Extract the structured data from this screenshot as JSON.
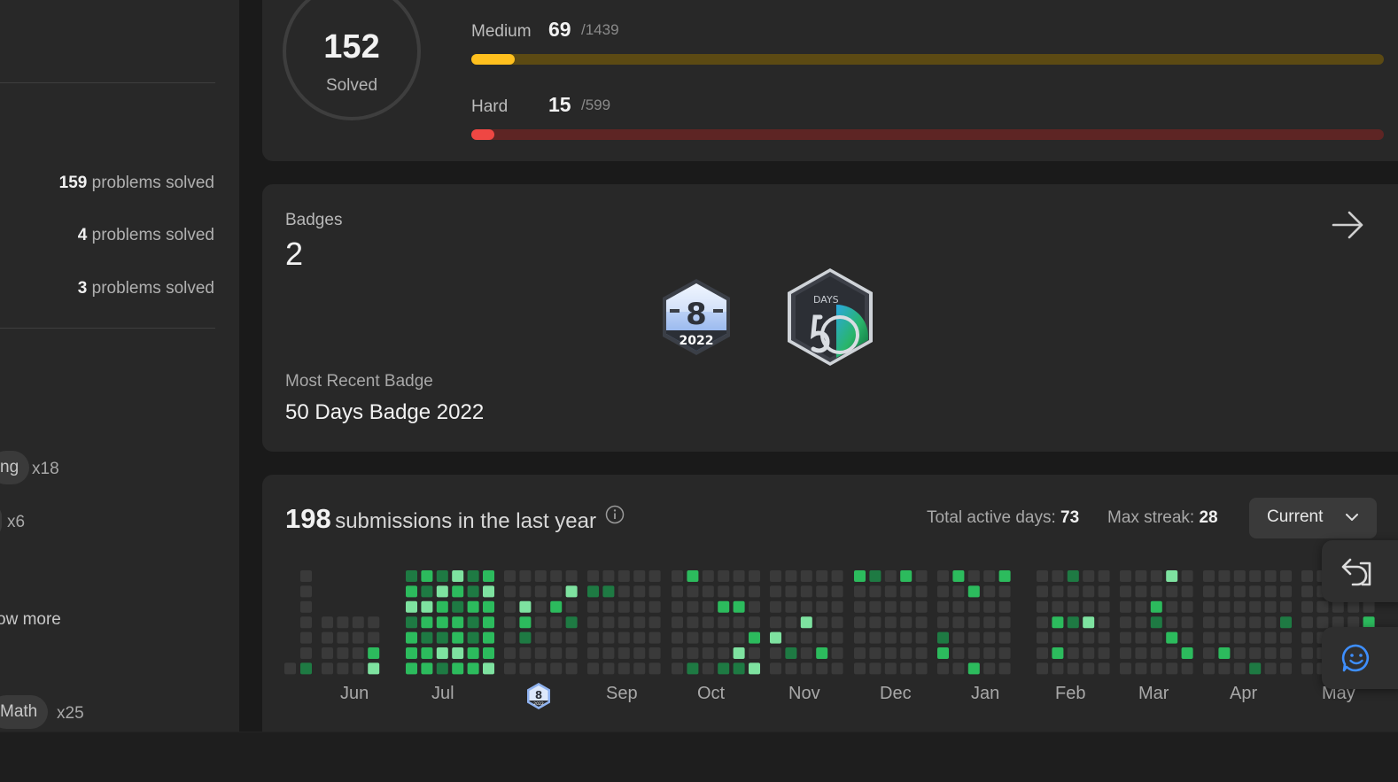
{
  "languages": [
    {
      "count": "159",
      "suffix": "problems solved"
    },
    {
      "count": "4",
      "suffix": "problems solved"
    },
    {
      "count": "3",
      "suffix": "problems solved"
    }
  ],
  "skills": [
    {
      "name": "ng",
      "count": "x18"
    },
    {
      "name": "",
      "count": "x6"
    },
    {
      "name": "Math",
      "count": "x25"
    }
  ],
  "show_more": "ow more",
  "solved": {
    "count": "152",
    "label": "Solved"
  },
  "difficulties": [
    {
      "label": "Medium",
      "solved": "69",
      "total": "/1439",
      "progress": 0.048,
      "color": "#ffc01e",
      "track": "#5c4a13"
    },
    {
      "label": "Hard",
      "solved": "15",
      "total": "/599",
      "progress": 0.025,
      "color": "#ef4743",
      "track": "#5e2524"
    }
  ],
  "badges": {
    "label": "Badges",
    "count": "2",
    "recent_label": "Most Recent Badge",
    "recent_name": "50 Days Badge 2022",
    "badge_1_text": {
      "number": "8",
      "year": "2022"
    },
    "badge_2_text": {
      "top": "DAYS",
      "number": "50"
    }
  },
  "calendar": {
    "submissions": "198",
    "submissions_text": "submissions in the last year",
    "active_days_label": "Total active days:",
    "active_days": "73",
    "max_streak_label": "Max streak:",
    "max_streak": "28",
    "dropdown_value": "Current",
    "months": [
      "Jun",
      "Jul",
      "Sep",
      "Oct",
      "Nov",
      "Dec",
      "Jan",
      "Feb",
      "Mar",
      "Apr",
      "May"
    ],
    "month_badge": {
      "number": "8",
      "year": "2022"
    },
    "colors": {
      "empty": "#3a3a3a",
      "l1": "#1e7a43",
      "l2": "#2cbb5d",
      "l3": "#7ee2a0"
    }
  }
}
